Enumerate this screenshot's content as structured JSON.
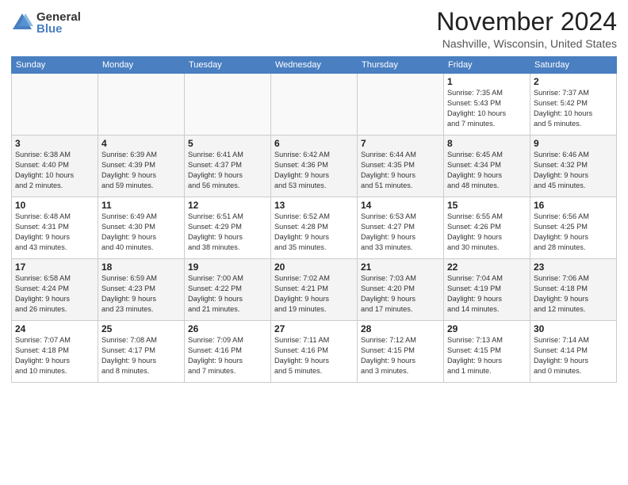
{
  "header": {
    "logo_general": "General",
    "logo_blue": "Blue",
    "month_title": "November 2024",
    "location": "Nashville, Wisconsin, United States"
  },
  "days_of_week": [
    "Sunday",
    "Monday",
    "Tuesday",
    "Wednesday",
    "Thursday",
    "Friday",
    "Saturday"
  ],
  "weeks": [
    {
      "alt": false,
      "days": [
        {
          "num": "",
          "info": ""
        },
        {
          "num": "",
          "info": ""
        },
        {
          "num": "",
          "info": ""
        },
        {
          "num": "",
          "info": ""
        },
        {
          "num": "",
          "info": ""
        },
        {
          "num": "1",
          "info": "Sunrise: 7:35 AM\nSunset: 5:43 PM\nDaylight: 10 hours\nand 7 minutes."
        },
        {
          "num": "2",
          "info": "Sunrise: 7:37 AM\nSunset: 5:42 PM\nDaylight: 10 hours\nand 5 minutes."
        }
      ]
    },
    {
      "alt": true,
      "days": [
        {
          "num": "3",
          "info": "Sunrise: 6:38 AM\nSunset: 4:40 PM\nDaylight: 10 hours\nand 2 minutes."
        },
        {
          "num": "4",
          "info": "Sunrise: 6:39 AM\nSunset: 4:39 PM\nDaylight: 9 hours\nand 59 minutes."
        },
        {
          "num": "5",
          "info": "Sunrise: 6:41 AM\nSunset: 4:37 PM\nDaylight: 9 hours\nand 56 minutes."
        },
        {
          "num": "6",
          "info": "Sunrise: 6:42 AM\nSunset: 4:36 PM\nDaylight: 9 hours\nand 53 minutes."
        },
        {
          "num": "7",
          "info": "Sunrise: 6:44 AM\nSunset: 4:35 PM\nDaylight: 9 hours\nand 51 minutes."
        },
        {
          "num": "8",
          "info": "Sunrise: 6:45 AM\nSunset: 4:34 PM\nDaylight: 9 hours\nand 48 minutes."
        },
        {
          "num": "9",
          "info": "Sunrise: 6:46 AM\nSunset: 4:32 PM\nDaylight: 9 hours\nand 45 minutes."
        }
      ]
    },
    {
      "alt": false,
      "days": [
        {
          "num": "10",
          "info": "Sunrise: 6:48 AM\nSunset: 4:31 PM\nDaylight: 9 hours\nand 43 minutes."
        },
        {
          "num": "11",
          "info": "Sunrise: 6:49 AM\nSunset: 4:30 PM\nDaylight: 9 hours\nand 40 minutes."
        },
        {
          "num": "12",
          "info": "Sunrise: 6:51 AM\nSunset: 4:29 PM\nDaylight: 9 hours\nand 38 minutes."
        },
        {
          "num": "13",
          "info": "Sunrise: 6:52 AM\nSunset: 4:28 PM\nDaylight: 9 hours\nand 35 minutes."
        },
        {
          "num": "14",
          "info": "Sunrise: 6:53 AM\nSunset: 4:27 PM\nDaylight: 9 hours\nand 33 minutes."
        },
        {
          "num": "15",
          "info": "Sunrise: 6:55 AM\nSunset: 4:26 PM\nDaylight: 9 hours\nand 30 minutes."
        },
        {
          "num": "16",
          "info": "Sunrise: 6:56 AM\nSunset: 4:25 PM\nDaylight: 9 hours\nand 28 minutes."
        }
      ]
    },
    {
      "alt": true,
      "days": [
        {
          "num": "17",
          "info": "Sunrise: 6:58 AM\nSunset: 4:24 PM\nDaylight: 9 hours\nand 26 minutes."
        },
        {
          "num": "18",
          "info": "Sunrise: 6:59 AM\nSunset: 4:23 PM\nDaylight: 9 hours\nand 23 minutes."
        },
        {
          "num": "19",
          "info": "Sunrise: 7:00 AM\nSunset: 4:22 PM\nDaylight: 9 hours\nand 21 minutes."
        },
        {
          "num": "20",
          "info": "Sunrise: 7:02 AM\nSunset: 4:21 PM\nDaylight: 9 hours\nand 19 minutes."
        },
        {
          "num": "21",
          "info": "Sunrise: 7:03 AM\nSunset: 4:20 PM\nDaylight: 9 hours\nand 17 minutes."
        },
        {
          "num": "22",
          "info": "Sunrise: 7:04 AM\nSunset: 4:19 PM\nDaylight: 9 hours\nand 14 minutes."
        },
        {
          "num": "23",
          "info": "Sunrise: 7:06 AM\nSunset: 4:18 PM\nDaylight: 9 hours\nand 12 minutes."
        }
      ]
    },
    {
      "alt": false,
      "days": [
        {
          "num": "24",
          "info": "Sunrise: 7:07 AM\nSunset: 4:18 PM\nDaylight: 9 hours\nand 10 minutes."
        },
        {
          "num": "25",
          "info": "Sunrise: 7:08 AM\nSunset: 4:17 PM\nDaylight: 9 hours\nand 8 minutes."
        },
        {
          "num": "26",
          "info": "Sunrise: 7:09 AM\nSunset: 4:16 PM\nDaylight: 9 hours\nand 7 minutes."
        },
        {
          "num": "27",
          "info": "Sunrise: 7:11 AM\nSunset: 4:16 PM\nDaylight: 9 hours\nand 5 minutes."
        },
        {
          "num": "28",
          "info": "Sunrise: 7:12 AM\nSunset: 4:15 PM\nDaylight: 9 hours\nand 3 minutes."
        },
        {
          "num": "29",
          "info": "Sunrise: 7:13 AM\nSunset: 4:15 PM\nDaylight: 9 hours\nand 1 minute."
        },
        {
          "num": "30",
          "info": "Sunrise: 7:14 AM\nSunset: 4:14 PM\nDaylight: 9 hours\nand 0 minutes."
        }
      ]
    }
  ]
}
